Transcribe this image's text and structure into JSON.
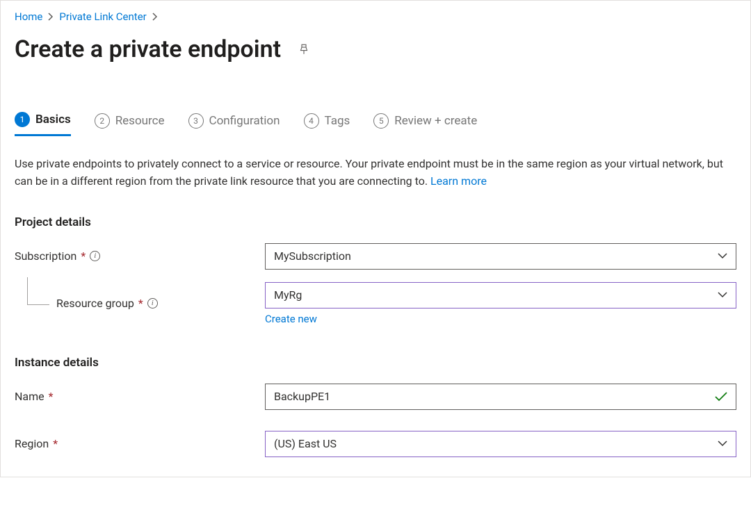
{
  "breadcrumb": {
    "home": "Home",
    "privateLinkCenter": "Private Link Center"
  },
  "page": {
    "title": "Create a private endpoint"
  },
  "tabs": {
    "basics": {
      "step": "1",
      "label": "Basics"
    },
    "resource": {
      "step": "2",
      "label": "Resource"
    },
    "configuration": {
      "step": "3",
      "label": "Configuration"
    },
    "tags": {
      "step": "4",
      "label": "Tags"
    },
    "review": {
      "step": "5",
      "label": "Review + create"
    }
  },
  "description": {
    "text": "Use private endpoints to privately connect to a service or resource. Your private endpoint must be in the same region as your virtual network, but can be in a different region from the private link resource that you are connecting to.  ",
    "learnMore": "Learn more"
  },
  "sections": {
    "project": {
      "heading": "Project details",
      "subscription": {
        "label": "Subscription",
        "value": "MySubscription"
      },
      "resourceGroup": {
        "label": "Resource group",
        "value": "MyRg",
        "createNew": "Create new"
      }
    },
    "instance": {
      "heading": "Instance details",
      "name": {
        "label": "Name",
        "value": "BackupPE1"
      },
      "region": {
        "label": "Region",
        "value": "(US) East US"
      }
    }
  }
}
